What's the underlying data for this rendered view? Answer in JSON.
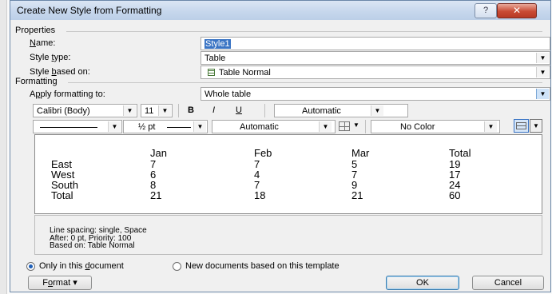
{
  "dialog": {
    "title": "Create New Style from Formatting",
    "help_label": "?",
    "close_label": "✕"
  },
  "properties": {
    "section_label": "Properties",
    "name_label_prefix": "",
    "name_label_accel": "N",
    "name_label_rest": "ame:",
    "name_value": "Style1",
    "style_type_label_prefix": "Style ",
    "style_type_label_accel": "t",
    "style_type_label_rest": "ype:",
    "style_type_value": "Table",
    "based_on_label_prefix": "Style ",
    "based_on_label_accel": "b",
    "based_on_label_rest": "ased on:",
    "based_on_value": "Table Normal"
  },
  "formatting": {
    "section_label": "Formatting",
    "apply_label_prefix": "A",
    "apply_label_accel": "p",
    "apply_label_rest": "ply formatting to:",
    "apply_value": "Whole table",
    "font_name": "Calibri (Body)",
    "font_size": "11",
    "bold_label": "B",
    "italic_label": "I",
    "underline_label": "U",
    "font_color": "Automatic",
    "border_weight": "½ pt",
    "border_color": "Automatic",
    "shading": "No Color"
  },
  "preview": {
    "headers": [
      "",
      "Jan",
      "Feb",
      "Mar",
      "Total"
    ],
    "rows": [
      [
        "East",
        "7",
        "7",
        "5",
        "19"
      ],
      [
        "West",
        "6",
        "4",
        "7",
        "17"
      ],
      [
        "South",
        "8",
        "7",
        "9",
        "24"
      ],
      [
        "Total",
        "21",
        "18",
        "21",
        "60"
      ]
    ]
  },
  "description": {
    "line1": "Line spacing:  single, Space",
    "line2": "After:  0 pt, Priority: 100",
    "line3": "Based on: Table Normal"
  },
  "options": {
    "only_doc_prefix": "Only in this ",
    "only_doc_accel": "d",
    "only_doc_rest": "ocument",
    "new_docs_label": "New documents based on this template",
    "only_doc_selected": true
  },
  "footer": {
    "format_accel": "o",
    "format_prefix": "F",
    "format_rest": "rmat",
    "format_arrow": "▾",
    "ok_label": "OK",
    "cancel_label": "Cancel"
  },
  "colors": {
    "accent": "#3a74c4",
    "title_bar": "#c5d6ec",
    "close": "#c94a34"
  }
}
